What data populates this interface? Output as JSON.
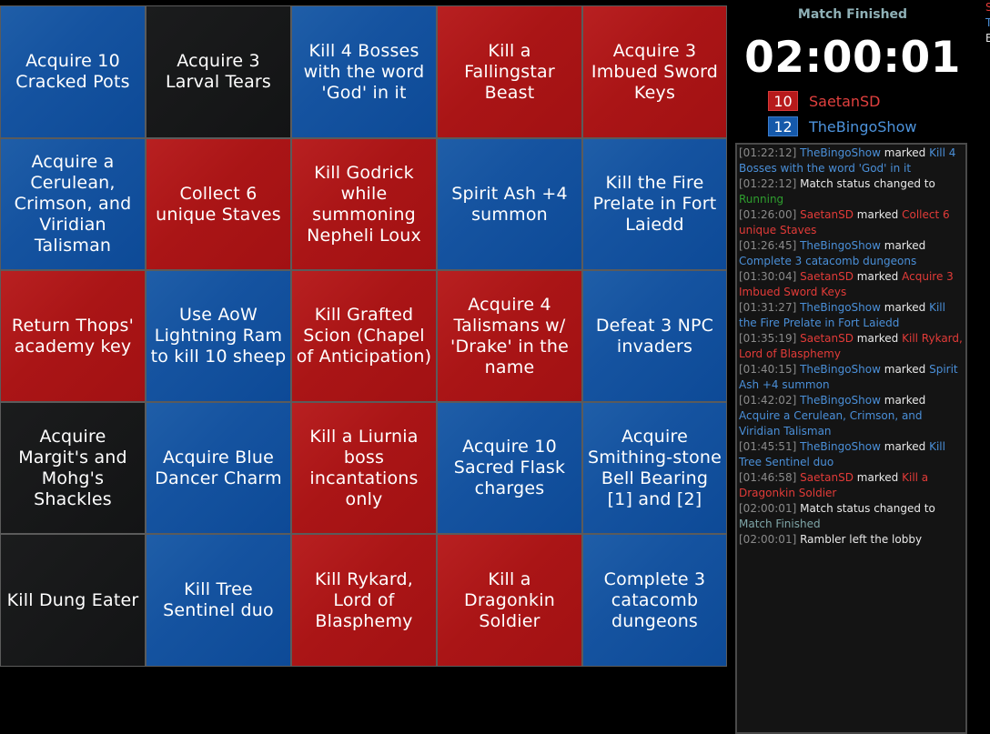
{
  "board": [
    {
      "text": "Acquire 10 Cracked Pots",
      "color": "blue"
    },
    {
      "text": "Acquire 3 Larval Tears",
      "color": "none"
    },
    {
      "text": "Kill 4 Bosses with the word 'God' in it",
      "color": "blue"
    },
    {
      "text": "Kill a Fallingstar Beast",
      "color": "red"
    },
    {
      "text": "Acquire 3 Imbued Sword Keys",
      "color": "red"
    },
    {
      "text": "Acquire a Cerulean, Crimson, and Viridian Talisman",
      "color": "blue"
    },
    {
      "text": "Collect 6 unique Staves",
      "color": "red"
    },
    {
      "text": "Kill Godrick while summoning Nepheli Loux",
      "color": "red"
    },
    {
      "text": "Spirit Ash +4 summon",
      "color": "blue"
    },
    {
      "text": "Kill the Fire Prelate in Fort Laiedd",
      "color": "blue"
    },
    {
      "text": "Return Thops' academy key",
      "color": "red"
    },
    {
      "text": "Use AoW Lightning Ram to kill 10 sheep",
      "color": "blue"
    },
    {
      "text": "Kill Grafted Scion (Chapel of Anticipation)",
      "color": "red"
    },
    {
      "text": "Acquire 4 Talismans w/ 'Drake' in the name",
      "color": "red"
    },
    {
      "text": "Defeat 3 NPC invaders",
      "color": "blue"
    },
    {
      "text": "Acquire Margit's and Mohg's Shackles",
      "color": "none"
    },
    {
      "text": "Acquire Blue Dancer Charm",
      "color": "blue"
    },
    {
      "text": "Kill a Liurnia boss incantations only",
      "color": "red"
    },
    {
      "text": "Acquire 10 Sacred Flask charges",
      "color": "blue"
    },
    {
      "text": "Acquire Smithing-stone Bell Bearing [1] and [2]",
      "color": "blue"
    },
    {
      "text": "Kill Dung Eater",
      "color": "none"
    },
    {
      "text": "Kill Tree Sentinel duo",
      "color": "blue"
    },
    {
      "text": "Kill Rykard, Lord of Blasphemy",
      "color": "red"
    },
    {
      "text": "Kill a Dragonkin Soldier",
      "color": "red"
    },
    {
      "text": "Complete 3 catacomb dungeons",
      "color": "blue"
    }
  ],
  "status": {
    "title": "Match Finished",
    "timer": "02:00:01"
  },
  "players": [
    {
      "score": "10",
      "name": "SaetanSD",
      "color": "red"
    },
    {
      "score": "12",
      "name": "TheBingoShow",
      "color": "blue"
    }
  ],
  "log": [
    {
      "ts": "[01:22:12]",
      "kind": "mark",
      "player": "TheBingoShow",
      "color": "blue",
      "verb": "marked",
      "item": "Kill 4 Bosses with the word 'God' in it"
    },
    {
      "ts": "[01:22:12]",
      "kind": "status",
      "text": "Match status changed to",
      "value": "Running",
      "vcolor": "green"
    },
    {
      "ts": "[01:26:00]",
      "kind": "mark",
      "player": "SaetanSD",
      "color": "red",
      "verb": "marked",
      "item": "Collect 6 unique Staves"
    },
    {
      "ts": "[01:26:45]",
      "kind": "mark",
      "player": "TheBingoShow",
      "color": "blue",
      "verb": "marked",
      "item": "Complete 3 catacomb dungeons"
    },
    {
      "ts": "[01:30:04]",
      "kind": "mark",
      "player": "SaetanSD",
      "color": "red",
      "verb": "marked",
      "item": "Acquire 3 Imbued Sword Keys"
    },
    {
      "ts": "[01:31:27]",
      "kind": "mark",
      "player": "TheBingoShow",
      "color": "blue",
      "verb": "marked",
      "item": "Kill the Fire Prelate in Fort Laiedd"
    },
    {
      "ts": "[01:35:19]",
      "kind": "mark",
      "player": "SaetanSD",
      "color": "red",
      "verb": "marked",
      "item": "Kill Rykard, Lord of Blasphemy"
    },
    {
      "ts": "[01:40:15]",
      "kind": "mark",
      "player": "TheBingoShow",
      "color": "blue",
      "verb": "marked",
      "item": "Spirit Ash +4 summon"
    },
    {
      "ts": "[01:42:02]",
      "kind": "mark",
      "player": "TheBingoShow",
      "color": "blue",
      "verb": "marked",
      "item": "Acquire a Cerulean, Crimson, and Viridian Talisman"
    },
    {
      "ts": "[01:45:51]",
      "kind": "mark",
      "player": "TheBingoShow",
      "color": "blue",
      "verb": "marked",
      "item": "Kill Tree Sentinel duo"
    },
    {
      "ts": "[01:46:58]",
      "kind": "mark",
      "player": "SaetanSD",
      "color": "red",
      "verb": "marked",
      "item": "Kill a Dragonkin Soldier"
    },
    {
      "ts": "[02:00:01]",
      "kind": "status",
      "text": "Match status changed to",
      "value": "Match Finished",
      "vcolor": "teal"
    },
    {
      "ts": "[02:00:01]",
      "kind": "plain",
      "text": "Rambler left the lobby"
    }
  ],
  "edge": [
    {
      "text": "S",
      "color": "#e23b38"
    },
    {
      "text": "T",
      "color": "#4a8fd8"
    },
    {
      "text": "B",
      "color": "#e8e8e8"
    }
  ]
}
